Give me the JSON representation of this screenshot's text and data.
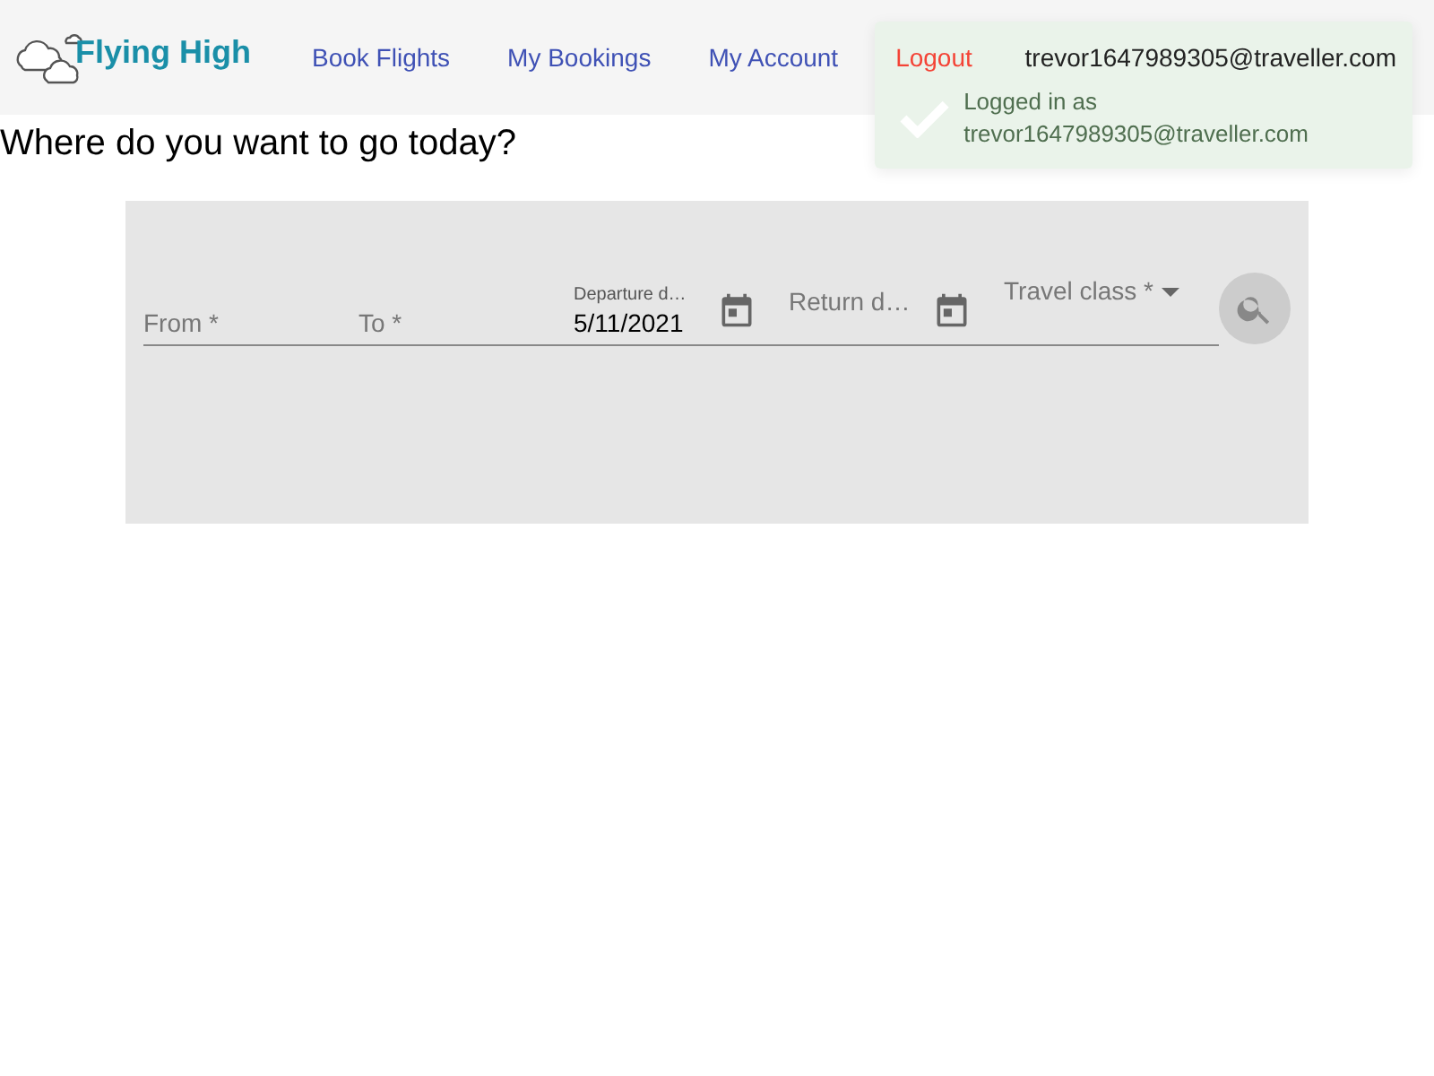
{
  "brand": {
    "name": "Flying High"
  },
  "nav": [
    {
      "label": "Book Flights",
      "kind": "link"
    },
    {
      "label": "My Bookings",
      "kind": "link"
    },
    {
      "label": "My Account",
      "kind": "link"
    },
    {
      "label": "Logout",
      "kind": "logout"
    }
  ],
  "user_email": "trevor1647989305@traveller.com",
  "toast": {
    "message": "Logged in as trevor1647989305@traveller.com"
  },
  "heading": "Where do you want to go today?",
  "search_form": {
    "fields": [
      {
        "kind": "text",
        "placeholder": "From *"
      },
      {
        "kind": "text",
        "placeholder": "To *"
      },
      {
        "kind": "date",
        "label": "Departure d…",
        "value": "5/11/2021"
      },
      {
        "kind": "date",
        "placeholder": "Return d…"
      },
      {
        "kind": "select",
        "placeholder": "Travel class *"
      }
    ]
  }
}
